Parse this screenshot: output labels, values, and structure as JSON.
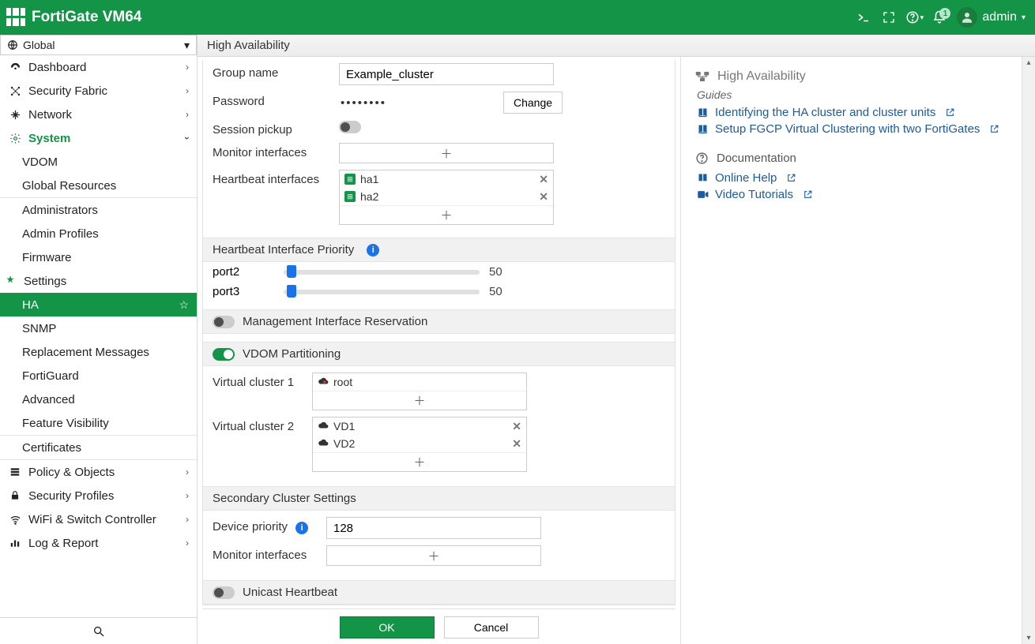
{
  "header": {
    "product": "FortiGate VM64",
    "alerts_count": "1",
    "user": "admin"
  },
  "vdom_selector": {
    "label": "Global"
  },
  "nav": {
    "dashboard": "Dashboard",
    "security_fabric": "Security Fabric",
    "network": "Network",
    "system": "System",
    "system_children": {
      "vdom": "VDOM",
      "global_resources": "Global Resources",
      "administrators": "Administrators",
      "admin_profiles": "Admin Profiles",
      "firmware": "Firmware",
      "settings": "Settings",
      "ha": "HA",
      "snmp": "SNMP",
      "replacement_messages": "Replacement Messages",
      "fortiguard": "FortiGuard",
      "advanced": "Advanced",
      "feature_visibility": "Feature Visibility",
      "certificates": "Certificates"
    },
    "policy_objects": "Policy & Objects",
    "security_profiles": "Security Profiles",
    "wifi_switch": "WiFi & Switch Controller",
    "log_report": "Log & Report"
  },
  "page": {
    "title": "High Availability"
  },
  "form": {
    "group_name_label": "Group name",
    "group_name_value": "Example_cluster",
    "password_label": "Password",
    "password_mask": "••••••••",
    "change_btn": "Change",
    "session_pickup_label": "Session pickup",
    "session_pickup_on": false,
    "monitor_ifaces_label": "Monitor interfaces",
    "heartbeat_ifaces_label": "Heartbeat interfaces",
    "heartbeat_ifaces": [
      "ha1",
      "ha2"
    ],
    "hb_priority_title": "Heartbeat Interface Priority",
    "hb_priority": [
      {
        "name": "port2",
        "value": "50"
      },
      {
        "name": "port3",
        "value": "50"
      }
    ],
    "mgmt_iface_res_label": "Management Interface Reservation",
    "mgmt_iface_res_on": false,
    "vdom_part_label": "VDOM Partitioning",
    "vdom_part_on": true,
    "vc1_label": "Virtual cluster 1",
    "vc1_items": [
      "root"
    ],
    "vc2_label": "Virtual cluster 2",
    "vc2_items": [
      "VD1",
      "VD2"
    ],
    "secondary_title": "Secondary Cluster Settings",
    "device_priority_label": "Device priority",
    "device_priority_value": "128",
    "monitor_ifaces2_label": "Monitor interfaces",
    "unicast_hb_label": "Unicast Heartbeat",
    "unicast_hb_on": false
  },
  "footer": {
    "ok": "OK",
    "cancel": "Cancel"
  },
  "help": {
    "title": "High Availability",
    "guides_label": "Guides",
    "guide1": "Identifying the HA cluster and cluster units",
    "guide2": "Setup FGCP Virtual Clustering with two FortiGates",
    "doc_label": "Documentation",
    "online_help": "Online Help",
    "video_tutorials": "Video Tutorials"
  }
}
